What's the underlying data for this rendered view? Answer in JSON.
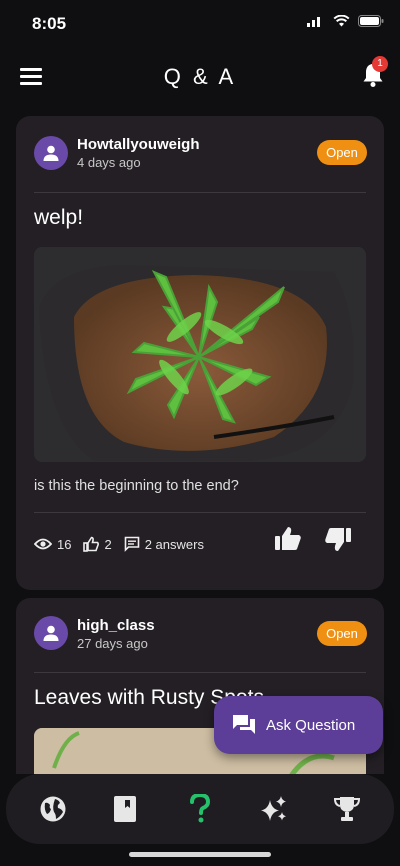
{
  "status_bar": {
    "time": "8:05"
  },
  "header": {
    "title": "Q & A",
    "notification_count": "1"
  },
  "posts": [
    {
      "username": "Howtallyouweigh",
      "time_ago": "4 days ago",
      "status": "Open",
      "title": "welp!",
      "body": "is this the beginning to the end?",
      "views": "16",
      "likes": "2",
      "answers": "2 answers"
    },
    {
      "username": "high_class",
      "time_ago": "27 days ago",
      "status": "Open",
      "title": "Leaves with Rusty Spots"
    }
  ],
  "fab": {
    "label": "Ask Question"
  },
  "nav": {
    "items": [
      "globe-icon",
      "book-icon",
      "question-icon",
      "sparkles-icon",
      "trophy-icon"
    ],
    "active_color": "#25c26b"
  },
  "colors": {
    "status_pill": "#f09012",
    "accent": "#5c3d97",
    "card": "#231f24"
  }
}
